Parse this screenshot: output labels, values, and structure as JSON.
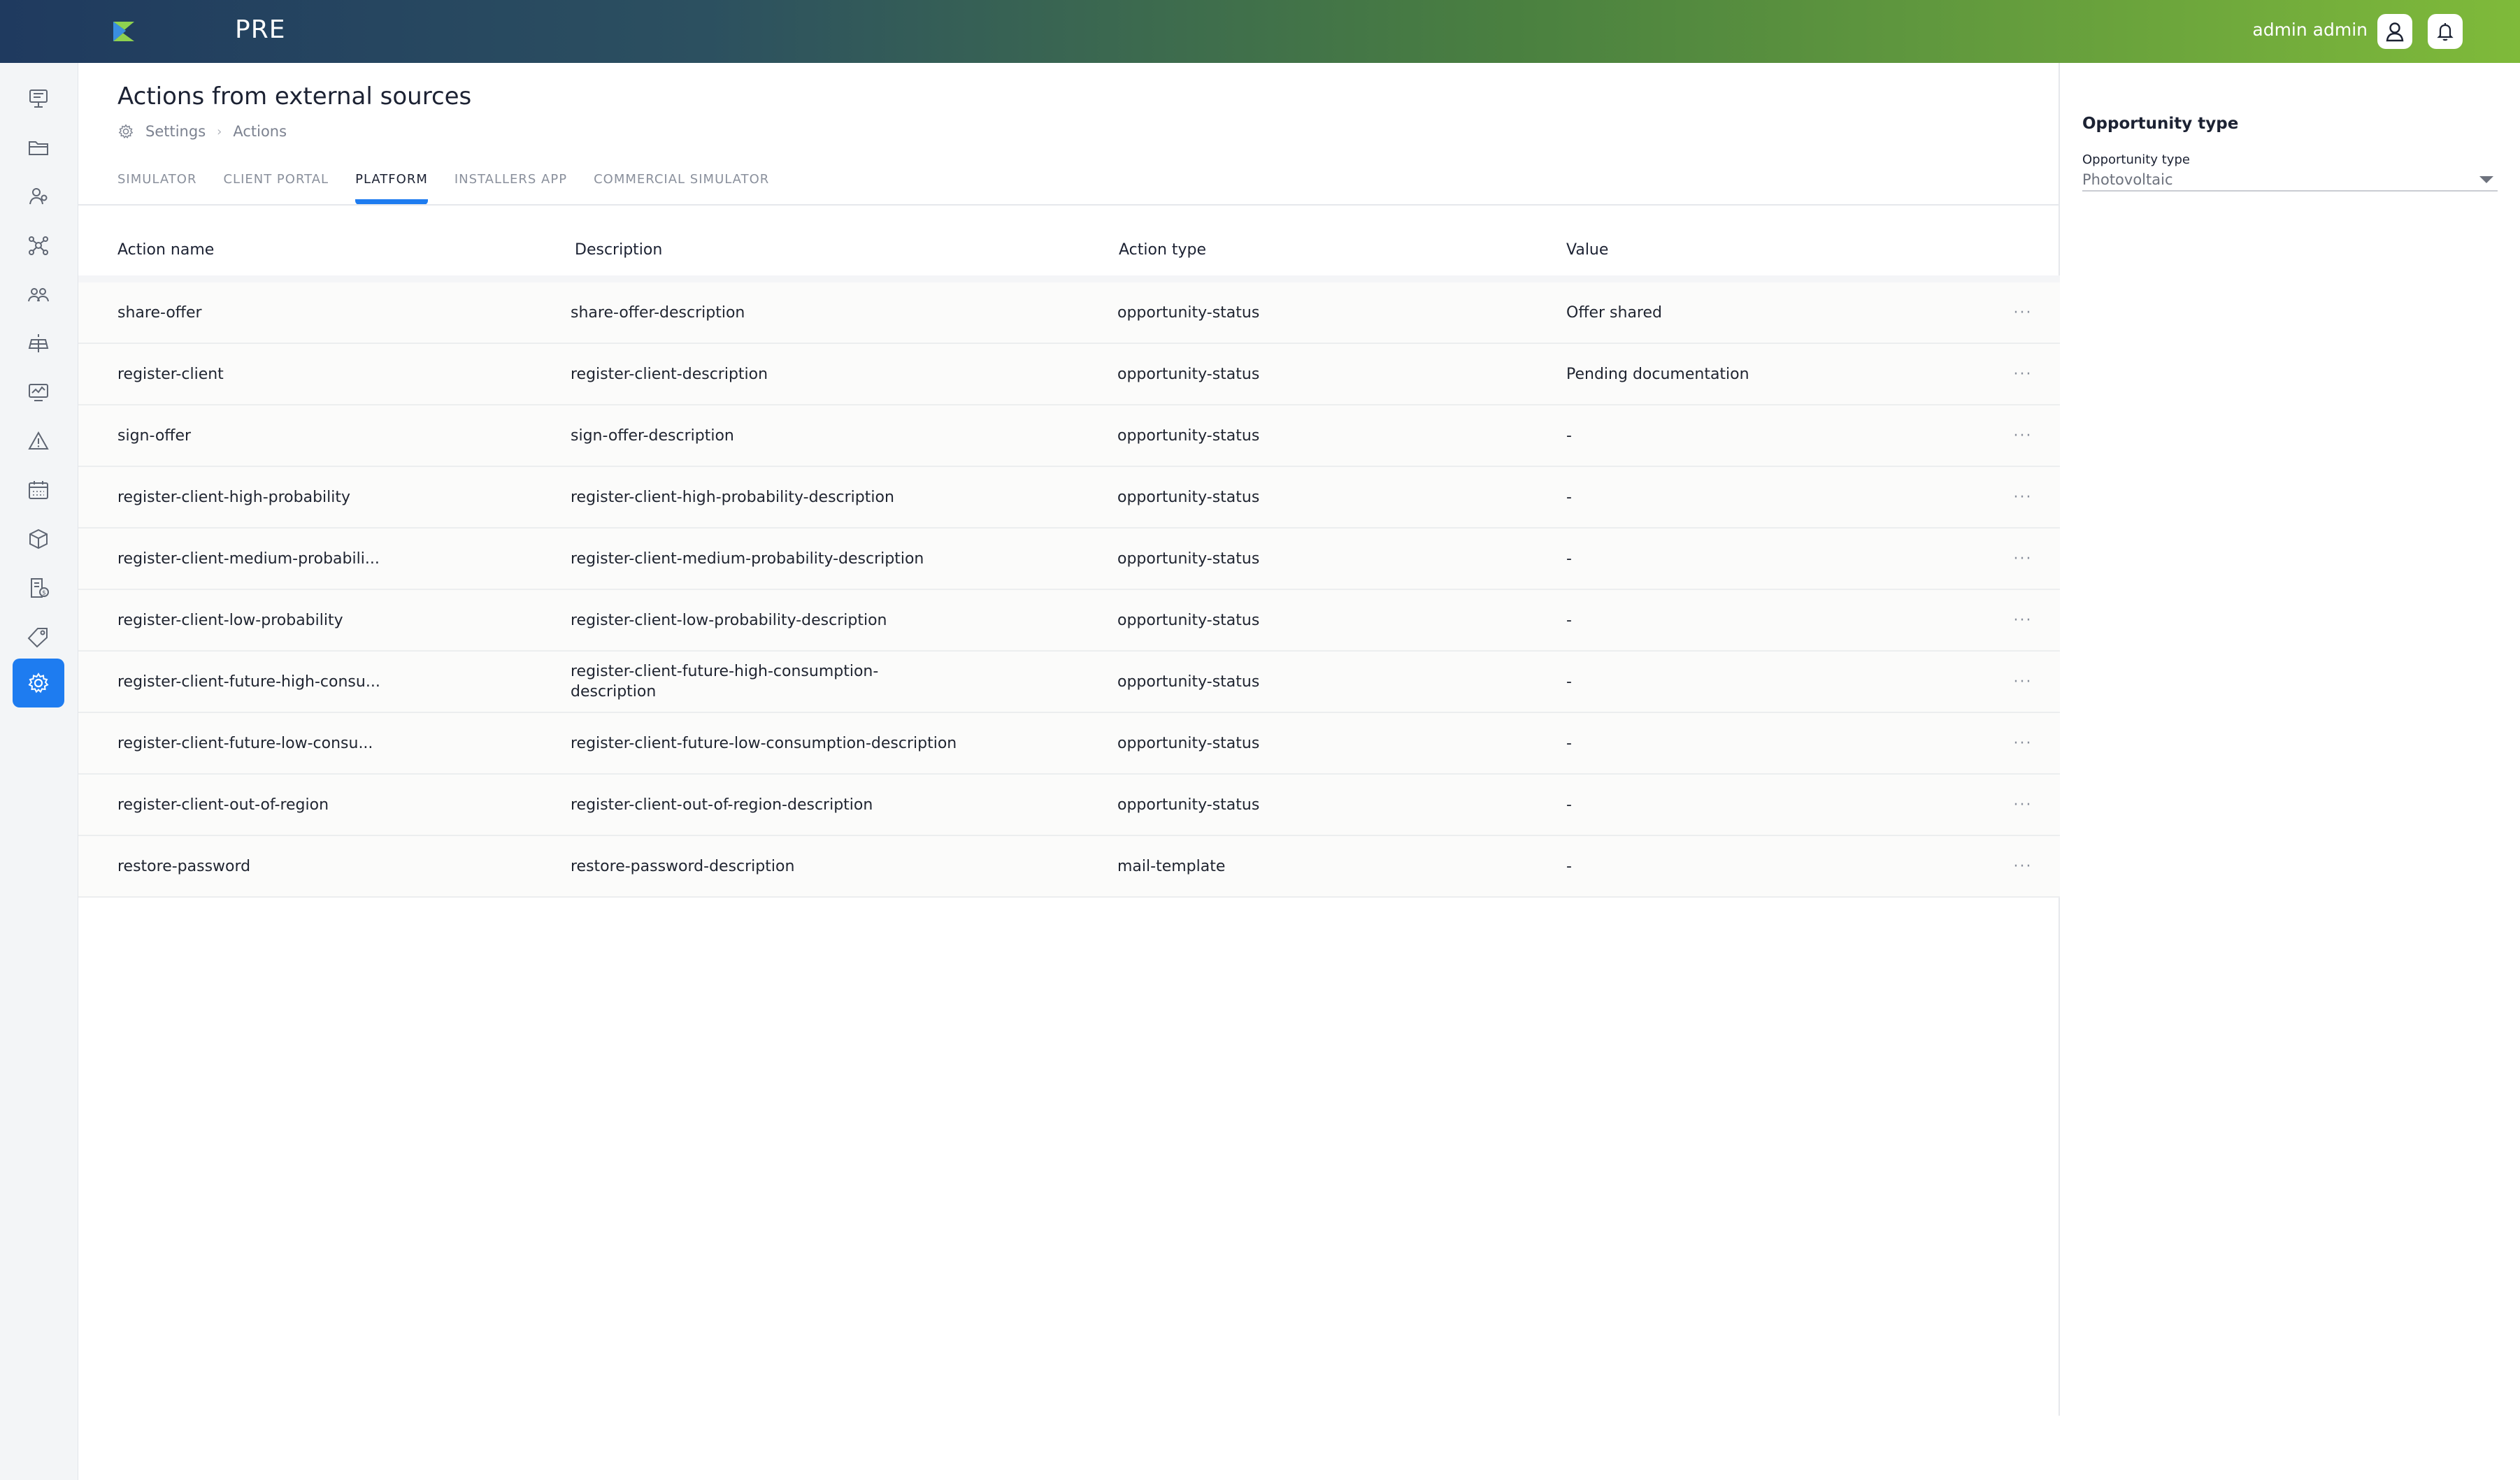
{
  "header": {
    "env_label": "PRE",
    "user_name": "admin admin",
    "colors": {
      "gradient_start": "#1f3a5f",
      "gradient_end": "#7fba3a"
    }
  },
  "sidebar": {
    "items": [
      {
        "icon": "dashboard-icon"
      },
      {
        "icon": "folder-icon"
      },
      {
        "icon": "users-icon"
      },
      {
        "icon": "network-icon"
      },
      {
        "icon": "group-icon"
      },
      {
        "icon": "solar-panel-icon"
      },
      {
        "icon": "monitor-icon"
      },
      {
        "icon": "warning-icon"
      },
      {
        "icon": "calendar-icon"
      },
      {
        "icon": "box-icon"
      },
      {
        "icon": "billing-icon"
      },
      {
        "icon": "tag-icon"
      },
      {
        "icon": "settings-icon",
        "active": true
      }
    ],
    "active_color": "#1e7cf0"
  },
  "page": {
    "title": "Actions from external sources",
    "breadcrumb": [
      "Settings",
      "Actions"
    ]
  },
  "tabs": [
    {
      "label": "SIMULATOR"
    },
    {
      "label": "CLIENT PORTAL"
    },
    {
      "label": "PLATFORM",
      "active": true
    },
    {
      "label": "INSTALLERS APP"
    },
    {
      "label": "COMMERCIAL SIMULATOR"
    }
  ],
  "table": {
    "columns": [
      "Action name",
      "Description",
      "Action type",
      "Value"
    ],
    "rows": [
      {
        "name": "share-offer",
        "description": "share-offer-description",
        "type": "opportunity-status",
        "value": "Offer shared"
      },
      {
        "name": "register-client",
        "description": "register-client-description",
        "type": "opportunity-status",
        "value": "Pending documentation"
      },
      {
        "name": "sign-offer",
        "description": "sign-offer-description",
        "type": "opportunity-status",
        "value": "-"
      },
      {
        "name": "register-client-high-probability",
        "description": "register-client-high-probability-description",
        "type": "opportunity-status",
        "value": "-"
      },
      {
        "name": "register-client-medium-probabili...",
        "description": "register-client-medium-probability-description",
        "type": "opportunity-status",
        "value": "-"
      },
      {
        "name": "register-client-low-probability",
        "description": "register-client-low-probability-description",
        "type": "opportunity-status",
        "value": "-"
      },
      {
        "name": "register-client-future-high-consu...",
        "description": "register-client-future-high-consumption-description",
        "type": "opportunity-status",
        "value": "-"
      },
      {
        "name": "register-client-future-low-consu...",
        "description": "register-client-future-low-consumption-description",
        "type": "opportunity-status",
        "value": "-"
      },
      {
        "name": "register-client-out-of-region",
        "description": "register-client-out-of-region-description",
        "type": "opportunity-status",
        "value": "-"
      },
      {
        "name": "restore-password",
        "description": "restore-password-description",
        "type": "mail-template",
        "value": "-"
      }
    ],
    "row_menu_label": "···"
  },
  "panel": {
    "title": "Opportunity type",
    "field_label": "Opportunity type",
    "field_value": "Photovoltaic"
  }
}
